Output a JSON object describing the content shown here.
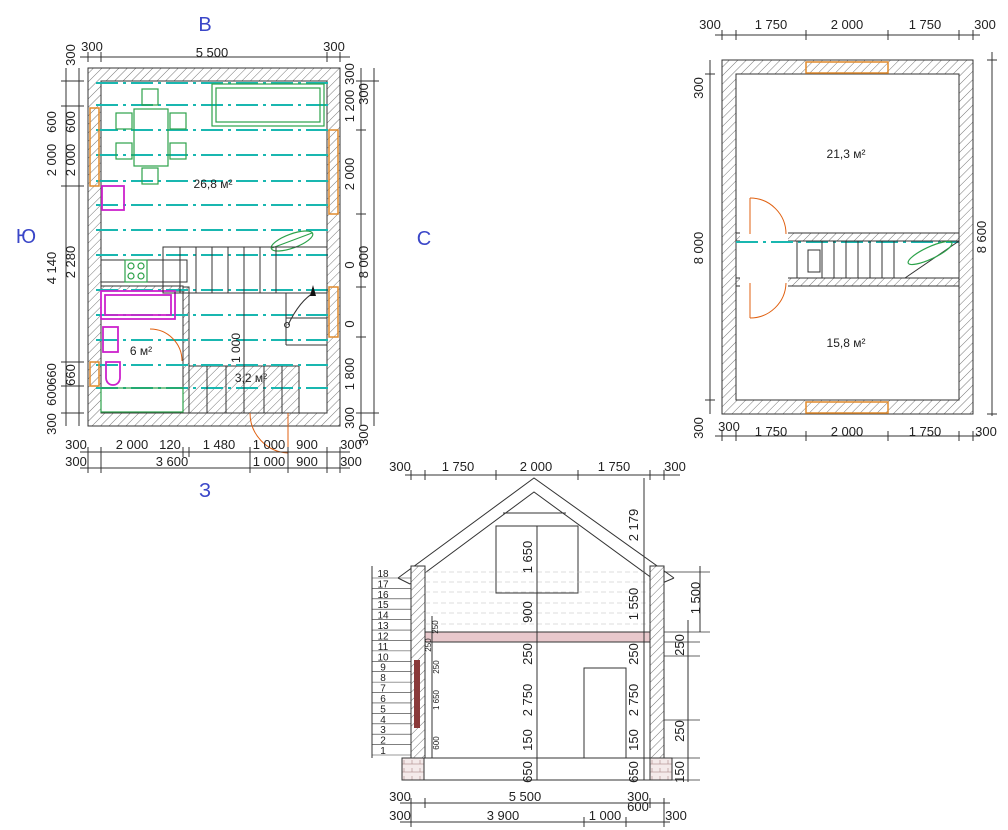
{
  "colors": {
    "direction_label": "#3a46c8",
    "beam": "#19b7b0",
    "window": "#e08a2c",
    "door": "#e06010",
    "furniture": "#2ca24a",
    "plumbing": "#cc22cc",
    "slab": "#e8c8cc"
  },
  "plan1": {
    "directions": {
      "north": "В",
      "south": "З",
      "west": "Ю",
      "east": "С"
    },
    "top_dims": [
      "300",
      "5 500",
      "300"
    ],
    "bottom_dims_row1": [
      "300",
      "2 000",
      "120",
      "1 480",
      "1 000",
      "900",
      "300"
    ],
    "bottom_dims_row2": [
      "300",
      "3 600",
      "1 000",
      "900",
      "300"
    ],
    "left_dims_outer": [
      "300",
      "600",
      "2 000",
      "4 140",
      "600",
      "300"
    ],
    "left_dims_inner": [
      "2 000",
      "2 280",
      "660"
    ],
    "left_dims_small": [
      "600",
      "660"
    ],
    "right_dims_inner": [
      "300",
      "1 200",
      "2 000",
      "0",
      "0",
      "1 800",
      "300"
    ],
    "right_dims_outer": [
      "300",
      "8 000",
      "300"
    ],
    "areas": {
      "living": "26,8 м²",
      "bath": "6 м²",
      "hall": "3,2 м²"
    },
    "stair_label": "1 000"
  },
  "plan2": {
    "top_dims": [
      "300",
      "1 750",
      "2 000",
      "1 750",
      "300"
    ],
    "bottom_dims": [
      "300",
      "1 750",
      "2 000",
      "1 750",
      "300"
    ],
    "left_dims": [
      "300",
      "8 000",
      "300"
    ],
    "right_dims": [
      "8 600"
    ],
    "areas": {
      "upper": "21,3 м²",
      "lower": "15,8 м²"
    }
  },
  "section": {
    "top_dims": [
      "300",
      "1 750",
      "2 000",
      "1 750",
      "300"
    ],
    "bottom_dims_row1": [
      "300",
      "5 500",
      "300",
      "600"
    ],
    "bottom_dims_row2": [
      "300",
      "3 900",
      "1 000",
      "300"
    ],
    "center_vertical": [
      "1 650",
      "900",
      "250",
      "2 750",
      "150",
      "650"
    ],
    "right_inner_vertical": [
      "2 179",
      "1 550",
      "250",
      "2 750",
      "150",
      "650"
    ],
    "right_outer_vertical": [
      "1 500",
      "250",
      "250",
      "150"
    ],
    "left_small_vertical": [
      "250",
      "250",
      "250",
      "1 650",
      "600"
    ],
    "level_numbers": [
      "18",
      "17",
      "16",
      "15",
      "14",
      "13",
      "12",
      "11",
      "10",
      "9",
      "8",
      "7",
      "6",
      "5",
      "4",
      "3",
      "2",
      "1"
    ]
  }
}
